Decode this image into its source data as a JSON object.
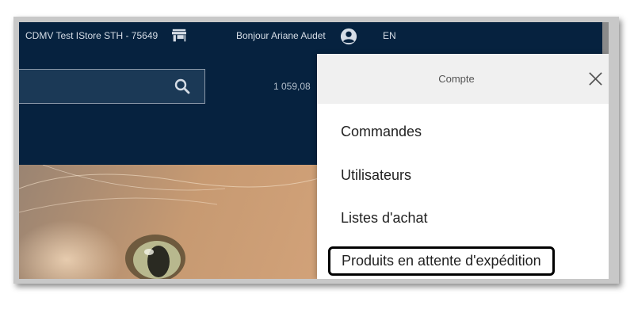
{
  "topbar": {
    "store_name": "CDMV Test IStore STH - 75649",
    "store_icon": "store-icon",
    "greeting": "Bonjour Ariane Audet",
    "user_icon": "account-circle-icon",
    "language": "EN"
  },
  "header": {
    "search_placeholder": "",
    "search_icon": "search-icon",
    "cart_total": "1 059,08"
  },
  "account_panel": {
    "title": "Compte",
    "close_icon": "close-icon",
    "items": [
      {
        "label": "Commandes"
      },
      {
        "label": "Utilisateurs"
      },
      {
        "label": "Listes d'achat"
      },
      {
        "label": "Produits en attente d'expédition",
        "highlighted": true
      }
    ]
  },
  "colors": {
    "navbar": "#06223f",
    "panel_bg": "#ffffff",
    "panel_header_bg": "#f0f0f0",
    "highlight_border": "#000000"
  }
}
